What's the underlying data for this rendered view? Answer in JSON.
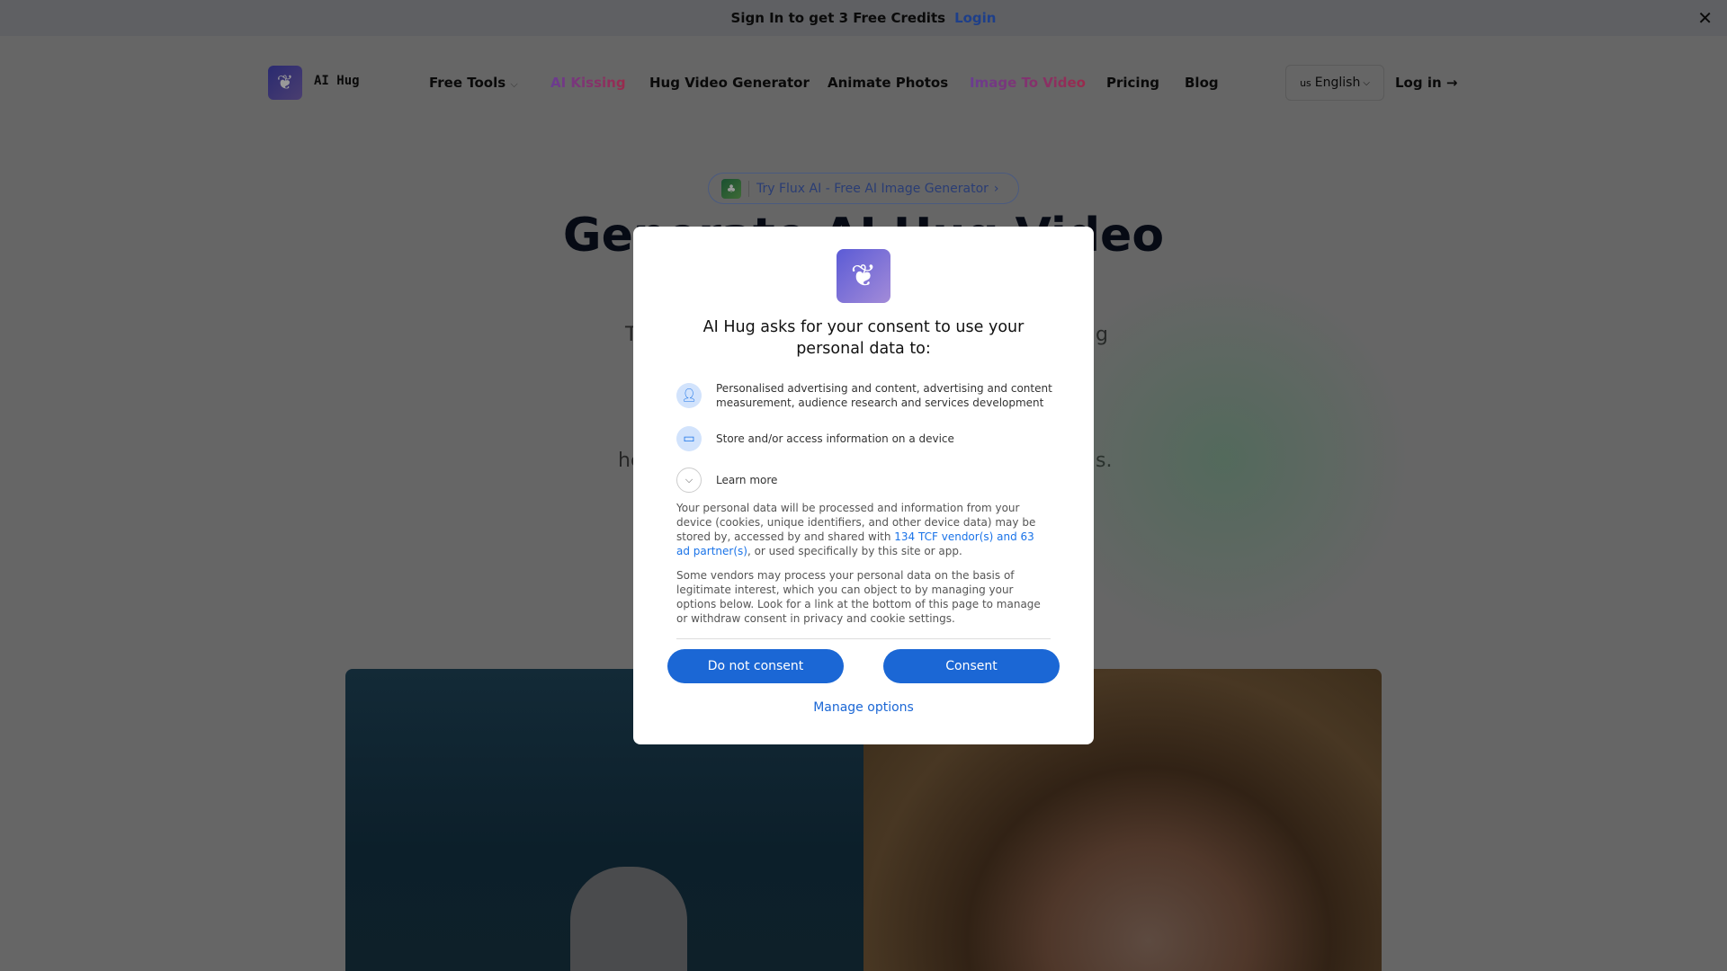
{
  "banner": {
    "text": "Sign In to get 3 Free Credits",
    "login": "Login",
    "close_icon": "close-icon"
  },
  "nav": {
    "brand": "AI Hug",
    "items": [
      {
        "label": "Free Tools",
        "dropdown": true
      },
      {
        "label": "AI Kissing",
        "highlight": true
      },
      {
        "label": "Hug Video Generator"
      },
      {
        "label": "Animate Photos"
      },
      {
        "label": "Image To Video",
        "highlight": true
      },
      {
        "label": "Pricing"
      },
      {
        "label": "Blog"
      }
    ],
    "language": {
      "flag": "us",
      "label": "English"
    },
    "login": "Log in →"
  },
  "hero": {
    "promo": "Try Flux AI - Free AI Image Generator",
    "title": "Generate AI Hug Video",
    "fragments": [
      "T",
      "g",
      "he",
      "s."
    ]
  },
  "consent": {
    "title": "AI Hug asks for your consent to use your personal data to:",
    "purposes": [
      {
        "icon": "person-icon",
        "text": "Personalised advertising and content, advertising and content measurement, audience research and services development"
      },
      {
        "icon": "devices-icon",
        "text": "Store and/or access information on a device"
      }
    ],
    "learn_more": "Learn more",
    "para1_before": "Your personal data will be processed and information from your device (cookies, unique identifiers, and other device data) may be stored by, accessed by and shared with ",
    "para1_link": "134 TCF vendor(s) and 63 ad partner(s)",
    "para1_after": ", or used specifically by this site or app.",
    "para2": "Some vendors may process your personal data on the basis of legitimate interest, which you can object to by managing your options below. Look for a link at the bottom of this page to manage or withdraw consent in privacy and cookie settings.",
    "do_not_consent": "Do not consent",
    "consent": "Consent",
    "manage_options": "Manage options"
  },
  "colors": {
    "button": "#1b67d5",
    "link": "#1a73e8",
    "overlay": "rgba(0,0,0,0.6)"
  }
}
